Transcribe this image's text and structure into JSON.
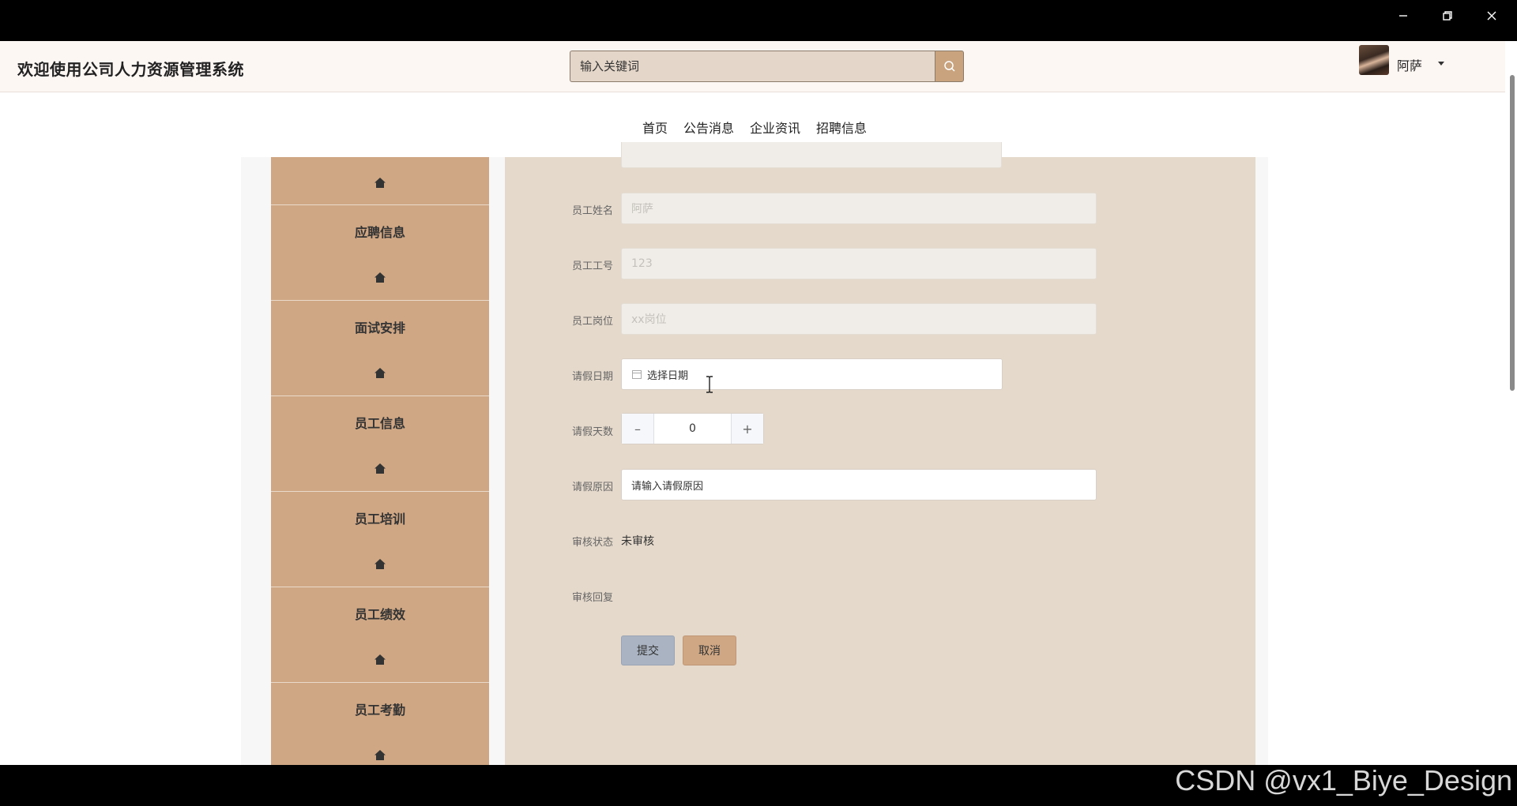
{
  "window": {
    "controls": [
      "minimize-icon",
      "restore-icon",
      "close-icon"
    ]
  },
  "header": {
    "site_title": "欢迎使用公司人力资源管理系统",
    "search_placeholder": "输入关键词",
    "user_name": "阿萨"
  },
  "nav": {
    "items": [
      "首页",
      "公告消息",
      "企业资讯",
      "招聘信息"
    ]
  },
  "sidebar": {
    "items": [
      {
        "label": ""
      },
      {
        "label": "应聘信息"
      },
      {
        "label": "面试安排"
      },
      {
        "label": "员工信息"
      },
      {
        "label": "员工培训"
      },
      {
        "label": "员工绩效"
      },
      {
        "label": "员工考勤"
      }
    ],
    "icon": "home-icon"
  },
  "form": {
    "employee_name": {
      "label": "员工姓名",
      "value": "阿萨"
    },
    "employee_no": {
      "label": "员工工号",
      "value": "123"
    },
    "employee_post": {
      "label": "员工岗位",
      "value": "xx岗位"
    },
    "leave_date": {
      "label": "请假日期",
      "placeholder": "选择日期"
    },
    "leave_days": {
      "label": "请假天数",
      "value": "0"
    },
    "leave_reason": {
      "label": "请假原因",
      "placeholder": "请输入请假原因"
    },
    "review_status": {
      "label": "审核状态",
      "value": "未审核"
    },
    "review_reply": {
      "label": "审核回复",
      "value": ""
    },
    "submit_label": "提交",
    "cancel_label": "取消"
  },
  "watermark": "CSDN @vx1_Biye_Design",
  "colors": {
    "accent": "#cfa784",
    "panel": "#e5d9cb",
    "submit": "#a9b3c2"
  }
}
